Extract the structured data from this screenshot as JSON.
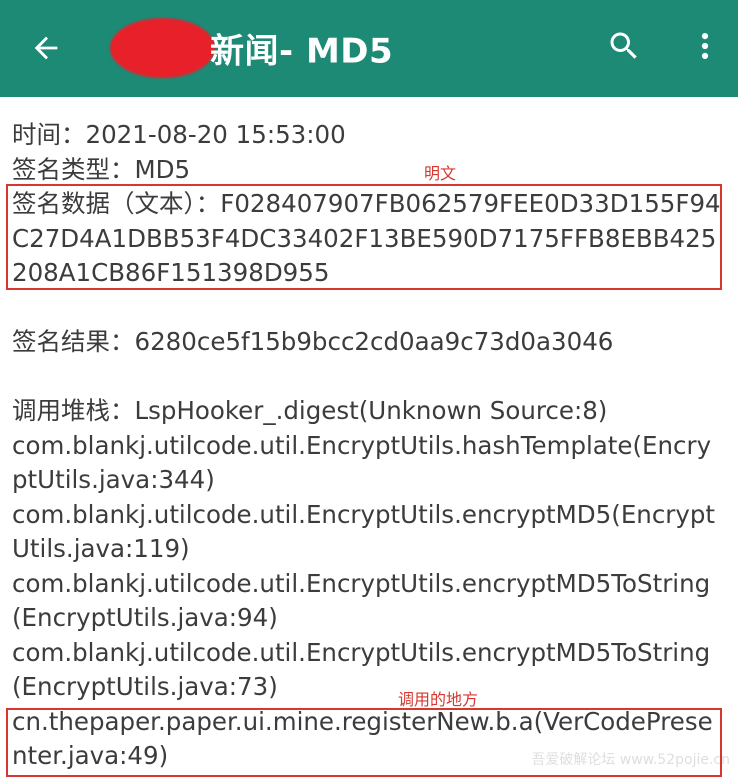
{
  "app_bar": {
    "title": "新闻- MD5",
    "back_icon": "arrow-back-icon",
    "search_icon": "search-icon",
    "more_icon": "more-vert-icon",
    "background": "#1c8a75"
  },
  "log": {
    "time": "时间：2021-08-20 15:53:00",
    "sign_type": "签名类型：MD5",
    "sign_data": "签名数据（文本）：F028407907FB062579FEE0D33D155F94C27D4A1DBB53F4DC33402F13BE590D7175FFB8EBB425208A1CB86F151398D955",
    "sign_result": "签名结果：6280ce5f15b9bcc2cd0aa9c73d0a3046",
    "stack_header": "调用堆栈：LspHooker_.digest(Unknown Source:8)",
    "stack": [
      "com.blankj.utilcode.util.EncryptUtils.hashTemplate(EncryptUtils.java:344)",
      "com.blankj.utilcode.util.EncryptUtils.encryptMD5(EncryptUtils.java:119)",
      "com.blankj.utilcode.util.EncryptUtils.encryptMD5ToString(EncryptUtils.java:94)",
      "com.blankj.utilcode.util.EncryptUtils.encryptMD5ToString(EncryptUtils.java:73)",
      "cn.thepaper.paper.ui.mine.registerNew.b.a(VerCodePresenter.java:49)"
    ]
  },
  "annotations": {
    "plaintext": "明文",
    "call_site": "调用的地方",
    "color": "#d6382f"
  },
  "watermark": "吾爱破解论坛 www.52pojie.cn"
}
